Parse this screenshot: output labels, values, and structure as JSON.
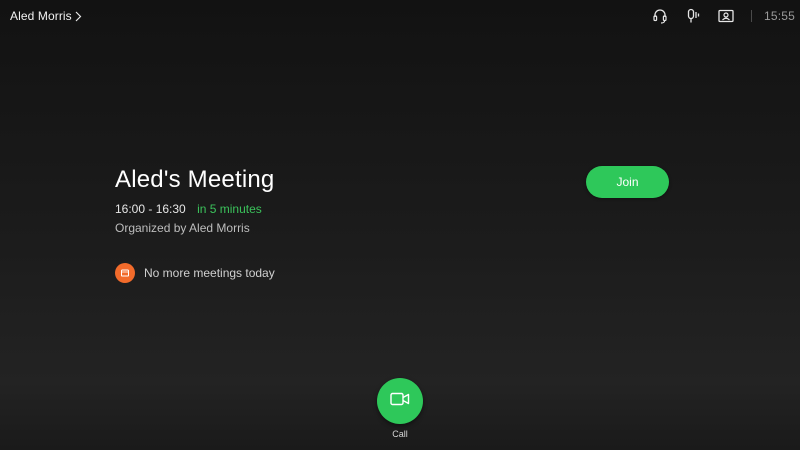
{
  "topbar": {
    "user_name": "Aled Morris",
    "icons": [
      "headset-icon",
      "microphone-icon",
      "self-view-icon"
    ],
    "clock": "15:55"
  },
  "meeting": {
    "title": "Aled's Meeting",
    "time_range": "16:00 - 16:30",
    "relative_time": "in 5 minutes",
    "organizer": "Organized by Aled Morris",
    "join_label": "Join"
  },
  "status": {
    "no_more_meetings": "No more meetings today"
  },
  "call": {
    "label": "Call"
  },
  "colors": {
    "accent_green": "#2ec85a",
    "relative_time_green": "#3bc25b",
    "status_orange": "#f26b2b",
    "background": "#161616"
  }
}
